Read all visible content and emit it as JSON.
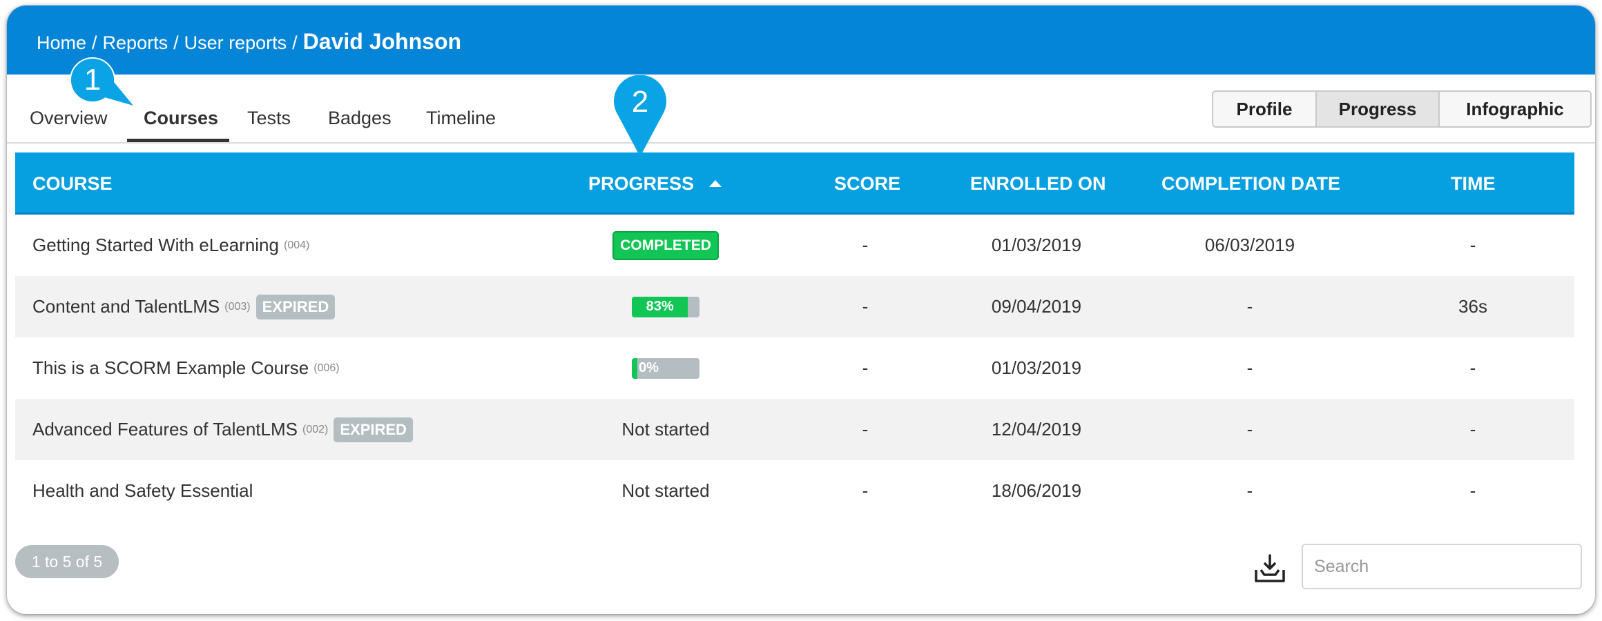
{
  "breadcrumb": {
    "home": "Home",
    "reports": "Reports",
    "user_reports": "User reports",
    "current": "David Johnson",
    "separator": "/"
  },
  "tabs": [
    {
      "label": "Overview"
    },
    {
      "label": "Courses"
    },
    {
      "label": "Tests"
    },
    {
      "label": "Badges"
    },
    {
      "label": "Timeline"
    }
  ],
  "active_tab": "Courses",
  "view_switch": {
    "profile": "Profile",
    "progress": "Progress",
    "infographic": "Infographic",
    "active": "Progress"
  },
  "table": {
    "headers": {
      "course": "COURSE",
      "progress": "PROGRESS",
      "score": "SCORE",
      "enrolled": "ENROLLED ON",
      "completion": "COMPLETION DATE",
      "time": "TIME"
    },
    "rows": [
      {
        "course": "Getting Started With eLearning",
        "code": "(004)",
        "expired": "",
        "progress_label": "COMPLETED",
        "progress_value": 1.0,
        "progress_text": "",
        "score": "-",
        "enrolled": "01/03/2019",
        "completion": "06/03/2019",
        "time": "-"
      },
      {
        "course": "Content and TalentLMS",
        "code": "(003)",
        "expired": "EXPIRED",
        "progress_label": "",
        "progress_value": 0.83,
        "progress_text": "83%",
        "score": "-",
        "enrolled": "09/04/2019",
        "completion": "-",
        "time": "36s"
      },
      {
        "course": "This is a SCORM Example Course",
        "code": "(006)",
        "expired": "",
        "progress_label": "",
        "progress_value": 0.0,
        "progress_text": "0%",
        "score": "-",
        "enrolled": "01/03/2019",
        "completion": "-",
        "time": "-"
      },
      {
        "course": "Advanced Features of TalentLMS",
        "code": "(002)",
        "expired": "EXPIRED",
        "progress_label": "",
        "progress_value": null,
        "progress_text": "Not started",
        "score": "-",
        "enrolled": "12/04/2019",
        "completion": "-",
        "time": "-"
      },
      {
        "course": "Health and Safety Essential",
        "code": "",
        "expired": "",
        "progress_label": "",
        "progress_value": null,
        "progress_text": "Not started",
        "score": "-",
        "enrolled": "18/06/2019",
        "completion": "-",
        "time": "-"
      }
    ]
  },
  "pager": "1 to 5 of 5",
  "search": {
    "placeholder": "Search",
    "value": ""
  },
  "markers": [
    {
      "number": "1"
    },
    {
      "number": "2"
    }
  ],
  "icons": {
    "export": "download-tray-icon",
    "sort": "sort-ascending-icon"
  },
  "colors": {
    "header": "#0585d8",
    "table_header": "#069fdf",
    "completed": "#11c654",
    "expired": "#b3bdc2",
    "marker": "#0aa3e6"
  }
}
